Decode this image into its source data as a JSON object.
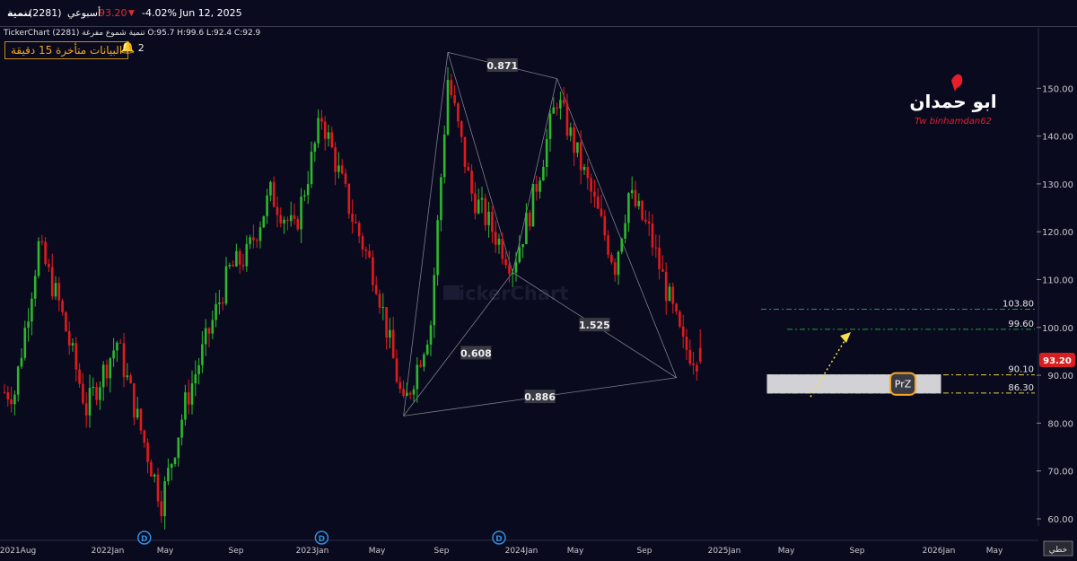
{
  "header": {
    "symbol_name": "تنمية",
    "symbol_code": "(2281)",
    "timeframe": "أسبوعي",
    "price": "93.20",
    "change": "-4.02%",
    "date": "Jun 12, 2025"
  },
  "info_line": {
    "brand": "TickerChart",
    "symbol": "(2281) تنمية",
    "style": "شموع مفرغة",
    "ohlc": "O:95.7  H:99.6  L:92.4  C:92.9"
  },
  "delay_notice": "البيانات متأخرة 15 دقيقة",
  "alerts_count": "2",
  "watermark": "TickerChart",
  "logo": {
    "arabic": "ابو حمدان",
    "latin": "Tw binhamdan62"
  },
  "pattern_labels": [
    "0.871",
    "0.608",
    "1.525",
    "0.886"
  ],
  "prz_label": "PrZ",
  "dividend_marker": "D",
  "footer_label": "خطي",
  "colors": {
    "up": "#2db82d",
    "down": "#e01b1b",
    "accent": "#f5a623",
    "level": "#1f9e3a",
    "prz": "#e6d13a",
    "background": "#0a0a1f"
  },
  "chart_data": {
    "type": "candlestick",
    "timeframe": "weekly",
    "ylim": [
      57,
      163
    ],
    "y_ticks": [
      "150.00",
      "140.00",
      "130.00",
      "120.00",
      "110.00",
      "100.00",
      "90.00",
      "80.00",
      "70.00",
      "60.00"
    ],
    "x_tick_labels": [
      "2021Aug",
      "2022Jan",
      "May",
      "Sep",
      "2023Jan",
      "May",
      "Sep",
      "2024Jan",
      "May",
      "Sep",
      "2025Jan",
      "May",
      "Sep",
      "2026Jan",
      "May"
    ],
    "last_price": "93.20",
    "levels": [
      {
        "label": "103.80",
        "value": 103.8
      },
      {
        "label": "99.60",
        "value": 99.6
      },
      {
        "label": "90.10",
        "value": 90.1
      },
      {
        "label": "86.30",
        "value": 86.3
      }
    ],
    "pattern": {
      "points": [
        {
          "date": "2023-10-09",
          "price": 81.5
        },
        {
          "date": "2024-01-08",
          "price": 157.5
        },
        {
          "date": "2024-05-20",
          "price": 111.5
        },
        {
          "date": "2024-08-19",
          "price": 152.0
        },
        {
          "date": "2025-04-21",
          "price": 89.5
        }
      ],
      "ratios": [
        "0.871",
        "0.608",
        "1.525",
        "0.886"
      ]
    },
    "prz": {
      "low": 86.3,
      "high": 90.1
    },
    "dividend_dates": [
      "2022-04-25",
      "2023-04-24",
      "2024-04-22"
    ],
    "anchors": [
      {
        "date": "2021-08-02",
        "price": 86.5
      },
      {
        "date": "2021-09-20",
        "price": 117.0
      },
      {
        "date": "2021-11-01",
        "price": 105.0
      },
      {
        "date": "2021-12-27",
        "price": 83.0
      },
      {
        "date": "2022-02-28",
        "price": 97.0
      },
      {
        "date": "2022-04-11",
        "price": 81.0
      },
      {
        "date": "2022-05-30",
        "price": 63.5
      },
      {
        "date": "2022-07-18",
        "price": 84.0
      },
      {
        "date": "2022-10-17",
        "price": 112.0
      },
      {
        "date": "2022-11-21",
        "price": 115.0
      },
      {
        "date": "2023-01-09",
        "price": 128.0
      },
      {
        "date": "2023-02-27",
        "price": 120.0
      },
      {
        "date": "2023-04-24",
        "price": 144.0
      },
      {
        "date": "2023-06-26",
        "price": 123.0
      },
      {
        "date": "2023-08-14",
        "price": 110.0
      },
      {
        "date": "2023-10-09",
        "price": 83.0
      },
      {
        "date": "2023-12-04",
        "price": 101.0
      },
      {
        "date": "2024-01-08",
        "price": 152.0
      },
      {
        "date": "2024-02-26",
        "price": 128.0
      },
      {
        "date": "2024-05-20",
        "price": 113.0
      },
      {
        "date": "2024-06-24",
        "price": 124.0
      },
      {
        "date": "2024-08-19",
        "price": 148.0
      },
      {
        "date": "2024-10-28",
        "price": 128.0
      },
      {
        "date": "2024-12-16",
        "price": 113.0
      },
      {
        "date": "2025-01-13",
        "price": 128.0
      },
      {
        "date": "2025-02-24",
        "price": 120.0
      },
      {
        "date": "2025-03-31",
        "price": 108.0
      },
      {
        "date": "2025-05-05",
        "price": 96.0
      },
      {
        "date": "2025-06-09",
        "price": 93.2
      }
    ]
  }
}
